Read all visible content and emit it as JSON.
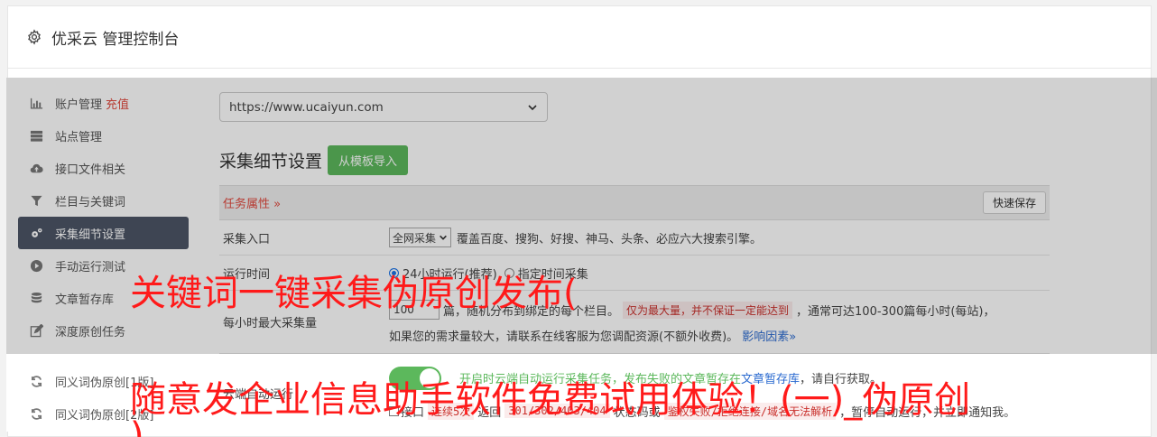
{
  "header": {
    "title": "优采云 管理控制台"
  },
  "sidebar": {
    "items": [
      {
        "label": "账户管理",
        "extra": "充值",
        "icon": "bar-chart-icon"
      },
      {
        "label": "站点管理",
        "icon": "server-icon"
      },
      {
        "label": "接口文件相关",
        "icon": "cloud-upload-icon"
      },
      {
        "label": "栏目与关键词",
        "icon": "filter-icon"
      },
      {
        "label": "采集细节设置",
        "icon": "gears-icon",
        "active": true
      },
      {
        "label": "手动运行测试",
        "icon": "play-circle-icon"
      },
      {
        "label": "文章暂存库",
        "icon": "database-icon"
      },
      {
        "label": "深度原创任务",
        "icon": "edit-icon"
      },
      {
        "label": "同义词伪原创[1版]",
        "icon": "refresh-icon"
      },
      {
        "label": "同义词伪原创[2版]",
        "icon": "refresh-icon"
      }
    ]
  },
  "main": {
    "site_select": "https://www.ucaiyun.com",
    "section_title": "采集细节设置",
    "template_button": "从模板导入",
    "task_label": "任务属性 »",
    "save_button": "快速保存",
    "rows": {
      "entry": {
        "label": "采集入口",
        "select": "全网采集",
        "desc": "覆盖百度、搜狗、好搜、神马、头条、必应六大搜索引擎。"
      },
      "runtime": {
        "label": "运行时间",
        "opt1": "24小时运行(推荐)",
        "opt2": "指定时间采集"
      },
      "max": {
        "label": "每小时最大采集量",
        "value": "100",
        "text1": "篇，随机分布到绑定的每个栏目。",
        "tag": "仅为最大量，并不保证一定能达到",
        "text2": "，通常可达100-300篇每小时(每站)，",
        "text3": "如果您的需求量较大，请联系在线客服为您调配资源(不额外收费)。",
        "link": "影响因素»"
      },
      "auto": {
        "label": "云端自动运行",
        "text1": "开启时云端自动运行采集任务，发布失败的文章暂存在",
        "link": "文章暂存库",
        "text2": "，请自行获取。"
      },
      "err": {
        "check": "接口",
        "tag1": "连续5次",
        "t1": "返回",
        "tag2": "301/302/403/404",
        "t2": "状态码或",
        "tag3": "鉴权失败/拒绝连接/域名无法解析",
        "t3": "，暂停自动运行，并立即通知我。"
      }
    }
  },
  "watermark": {
    "line1": "关键词一键采集伪原创发布(",
    "line2": "随意发企业信息助手软件免费试用体验！(一)_伪原创",
    "line3": ")"
  },
  "colors": {
    "accent_green": "#5cb85c",
    "active_nav": "#4c5566",
    "danger": "#e04a3f",
    "watermark": "#ff1a1a"
  }
}
